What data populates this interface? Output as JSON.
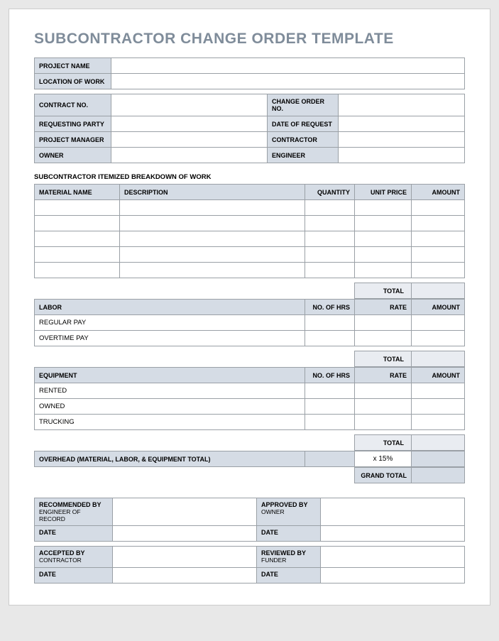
{
  "title": "SUBCONTRACTOR CHANGE ORDER TEMPLATE",
  "header": {
    "projectName": "PROJECT NAME",
    "locationOfWork": "LOCATION OF WORK",
    "contractNo": "CONTRACT NO.",
    "changeOrderNo": "CHANGE ORDER NO.",
    "requestingParty": "REQUESTING PARTY",
    "dateOfRequest": "DATE OF REQUEST",
    "projectManager": "PROJECT MANAGER",
    "contractor": "CONTRACTOR",
    "owner": "OWNER",
    "engineer": "ENGINEER"
  },
  "breakdown": {
    "sectionTitle": "SUBCONTRACTOR ITEMIZED BREAKDOWN OF WORK",
    "materialHeaders": {
      "materialName": "MATERIAL NAME",
      "description": "DESCRIPTION",
      "quantity": "QUANTITY",
      "unitPrice": "UNIT PRICE",
      "amount": "AMOUNT"
    },
    "totalLabel": "TOTAL",
    "laborHeader": "LABOR",
    "noOfHrs": "NO. OF HRS",
    "rate": "RATE",
    "laborRows": {
      "regularPay": "REGULAR PAY",
      "overtimePay": "OVERTIME PAY"
    },
    "equipmentHeader": "EQUIPMENT",
    "equipmentRows": {
      "rented": "RENTED",
      "owned": "OWNED",
      "trucking": "TRUCKING"
    },
    "overheadLabel": "OVERHEAD (MATERIAL, LABOR, & EQUIPMENT TOTAL)",
    "overheadRate": "x 15%",
    "grandTotal": "GRAND TOTAL"
  },
  "signatures": {
    "recommendedBy": "RECOMMENDED BY",
    "engineerOfRecord": "ENGINEER OF RECORD",
    "approvedBy": "APPROVED BY",
    "ownerSub": "OWNER",
    "date": "DATE",
    "acceptedBy": "ACCEPTED BY",
    "contractorSub": "CONTRACTOR",
    "reviewedBy": "REVIEWED BY",
    "funderSub": "FUNDER"
  }
}
